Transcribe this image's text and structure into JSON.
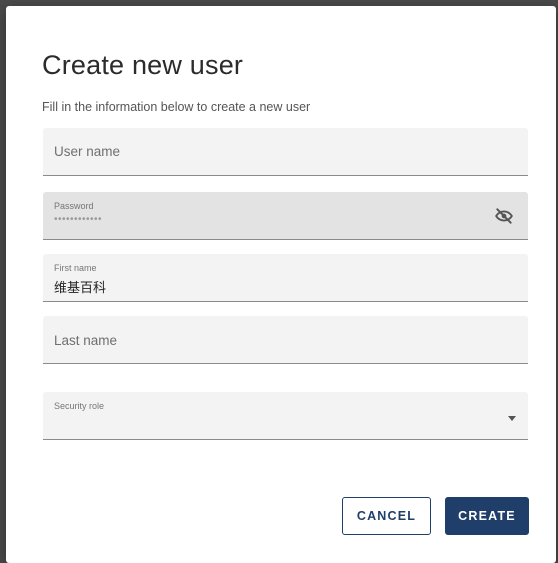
{
  "dialog": {
    "title": "Create new user",
    "subtitle": "Fill in the information below to create a new user"
  },
  "fields": {
    "username": {
      "placeholder": "User name",
      "value": ""
    },
    "password": {
      "label": "Password",
      "value": "••••••••••••",
      "disabled": true,
      "toggle_icon": "eye-off-icon"
    },
    "first_name": {
      "label": "First name",
      "value": "维基百科"
    },
    "last_name": {
      "placeholder": "Last name",
      "value": ""
    },
    "security_role": {
      "label": "Security role",
      "value": "",
      "dropdown_icon": "caret-down-icon"
    }
  },
  "actions": {
    "cancel_label": "CANCEL",
    "create_label": "CREATE"
  },
  "colors": {
    "primary": "#1f3f6a",
    "field_bg": "#f3f3f3",
    "field_disabled_bg": "#e3e3e3"
  }
}
